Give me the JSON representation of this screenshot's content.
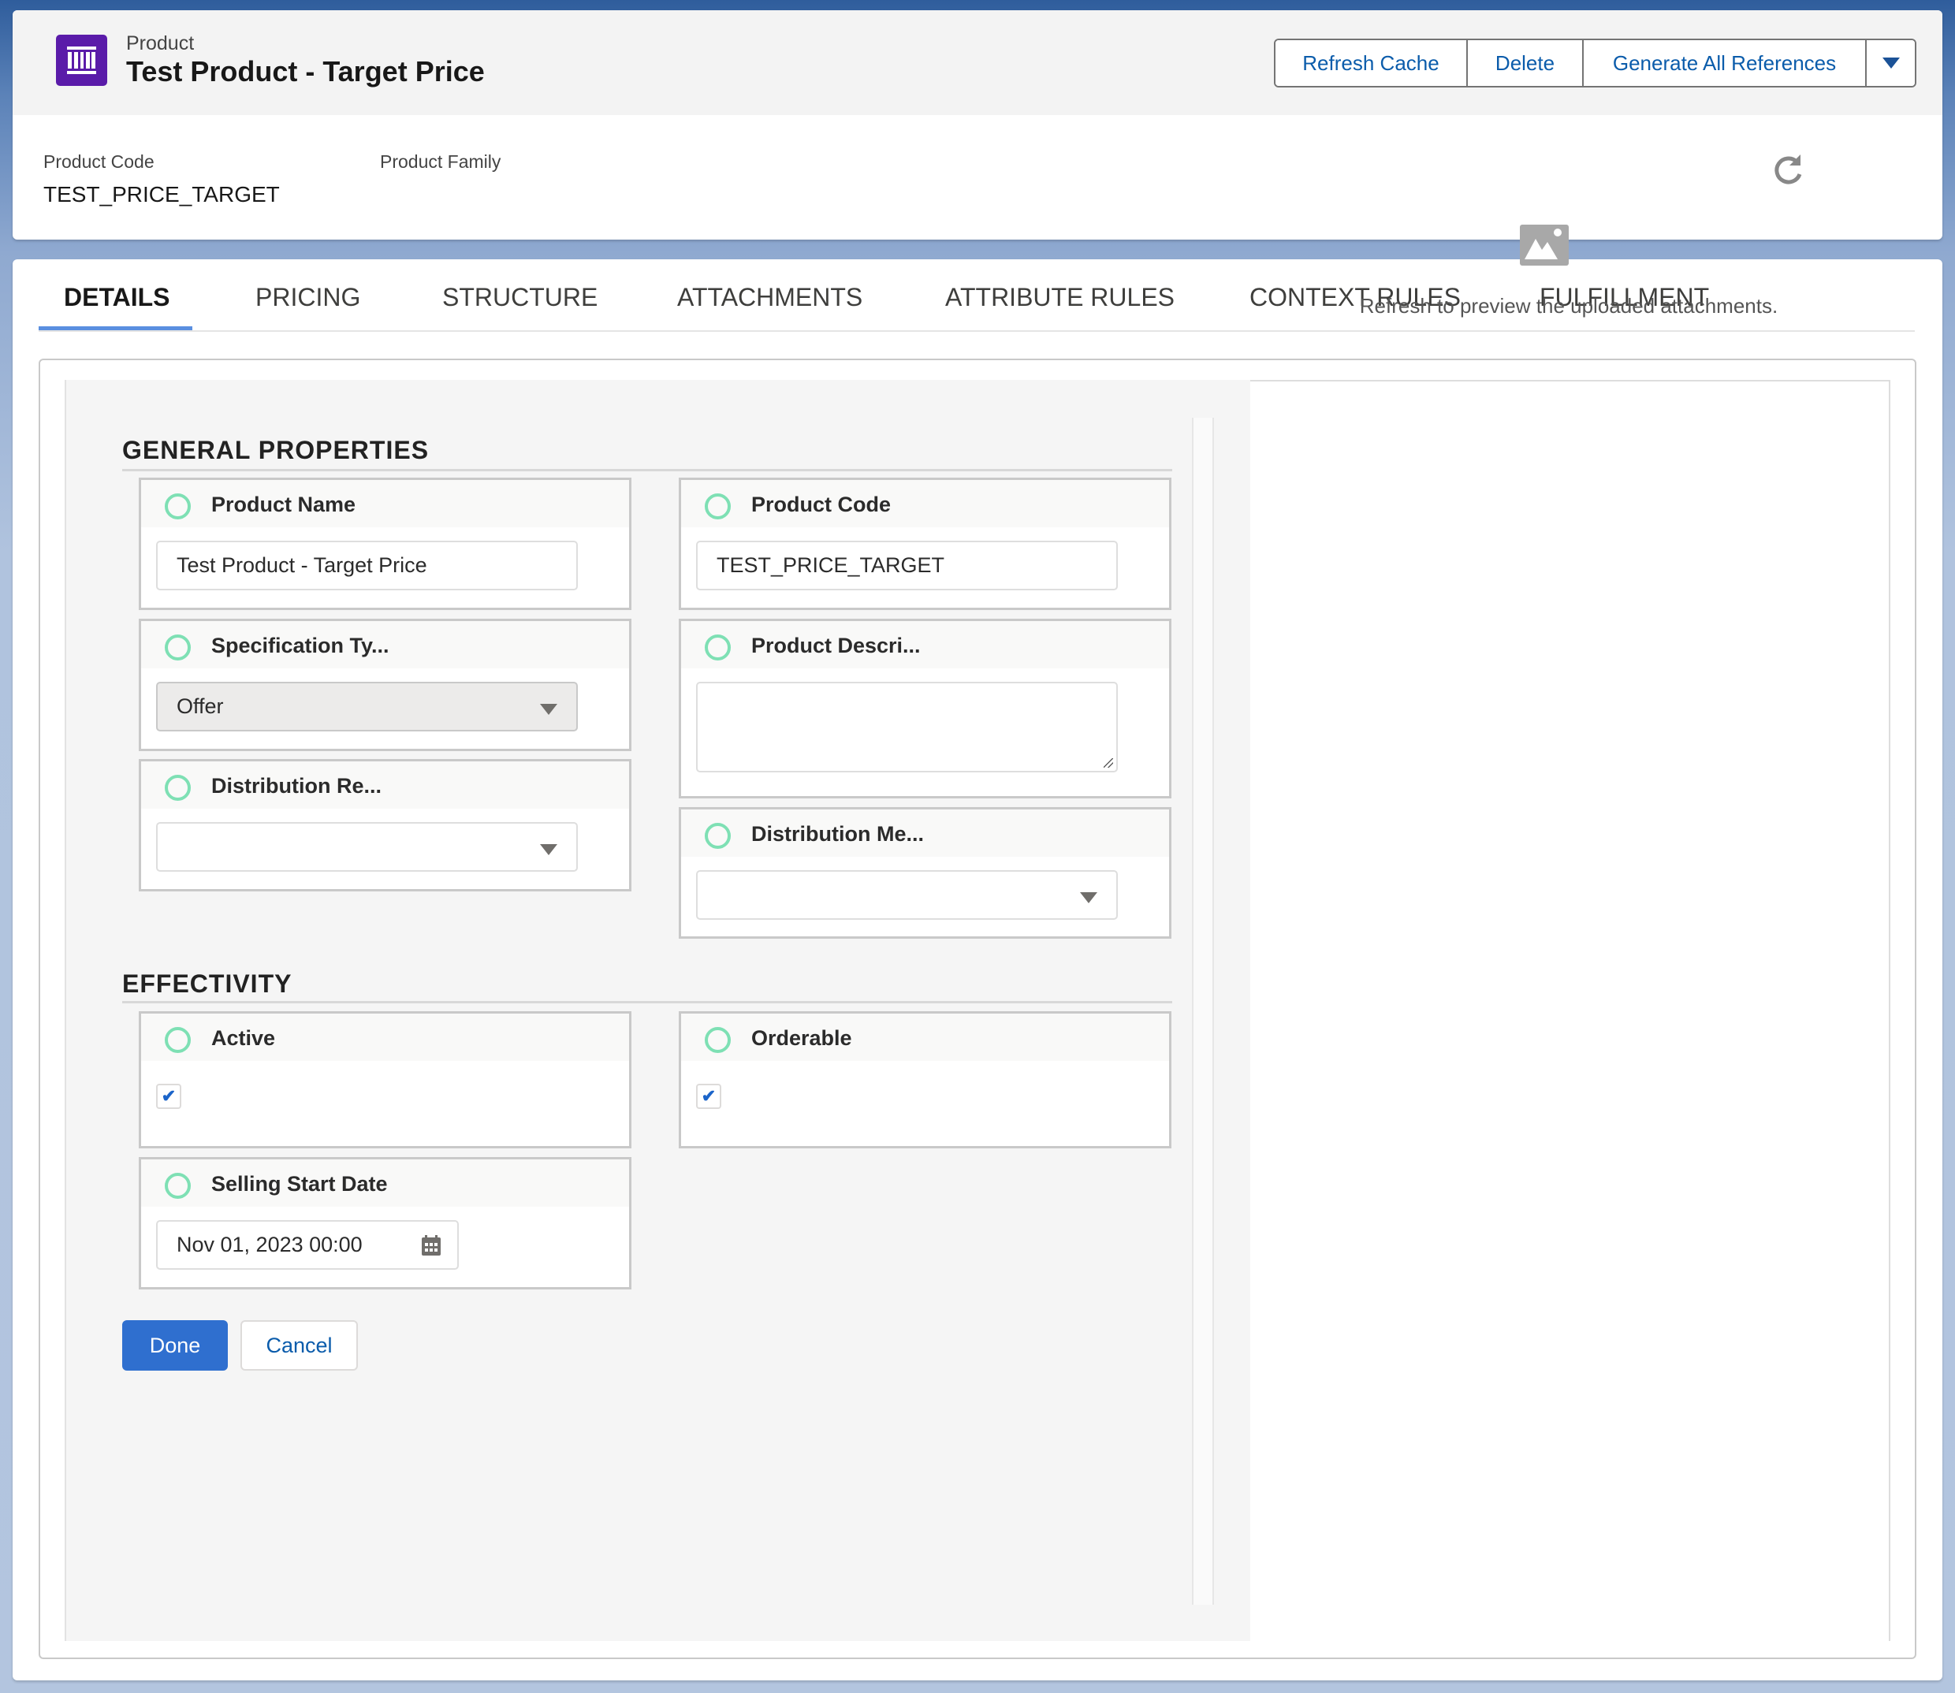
{
  "header": {
    "object_type": "Product",
    "title": "Test Product - Target Price",
    "icon": "product-icon",
    "brand_color": "#5a1ba9",
    "actions": [
      {
        "label": "Refresh Cache"
      },
      {
        "label": "Delete"
      },
      {
        "label": "Generate All References"
      }
    ],
    "more_actions_icon": "chevron-down-icon",
    "highlight_fields": [
      {
        "label": "Product Code",
        "value": "TEST_PRICE_TARGET"
      },
      {
        "label": "Product Family",
        "value": ""
      }
    ]
  },
  "tabs": [
    {
      "label": "DETAILS",
      "active": true
    },
    {
      "label": "PRICING",
      "active": false
    },
    {
      "label": "STRUCTURE",
      "active": false
    },
    {
      "label": "ATTACHMENTS",
      "active": false
    },
    {
      "label": "ATTRIBUTE RULES",
      "active": false
    },
    {
      "label": "CONTEXT RULES",
      "active": false
    },
    {
      "label": "FULFILLMENT",
      "active": false
    }
  ],
  "form": {
    "general": {
      "title": "GENERAL PROPERTIES",
      "fields": {
        "product_name": {
          "label": "Product Name",
          "value": "Test Product - Target Price"
        },
        "product_code": {
          "label": "Product Code",
          "value": "TEST_PRICE_TARGET"
        },
        "specification_type": {
          "label": "Specification Ty...",
          "value": "Offer"
        },
        "product_description": {
          "label": "Product Descri...",
          "value": ""
        },
        "distribution_re": {
          "label": "Distribution Re...",
          "value": ""
        },
        "distribution_me": {
          "label": "Distribution Me...",
          "value": ""
        }
      }
    },
    "effectivity": {
      "title": "EFFECTIVITY",
      "fields": {
        "active": {
          "label": "Active",
          "checked": true
        },
        "orderable": {
          "label": "Orderable",
          "checked": true
        },
        "selling_start_date": {
          "label": "Selling Start Date",
          "value": "Nov 01, 2023 00:00"
        }
      }
    },
    "buttons": {
      "done": "Done",
      "cancel": "Cancel"
    },
    "checkmark": "✔"
  },
  "preview": {
    "message": "Refresh to preview the uploaded attachments.",
    "refresh_icon": "refresh-icon",
    "placeholder_icon": "image-icon"
  },
  "colors": {
    "primary_button": "#2f6fcf",
    "link": "#0b5cab",
    "tab_underline": "#5a8fe0",
    "status_ring": "#7ee0b4"
  }
}
